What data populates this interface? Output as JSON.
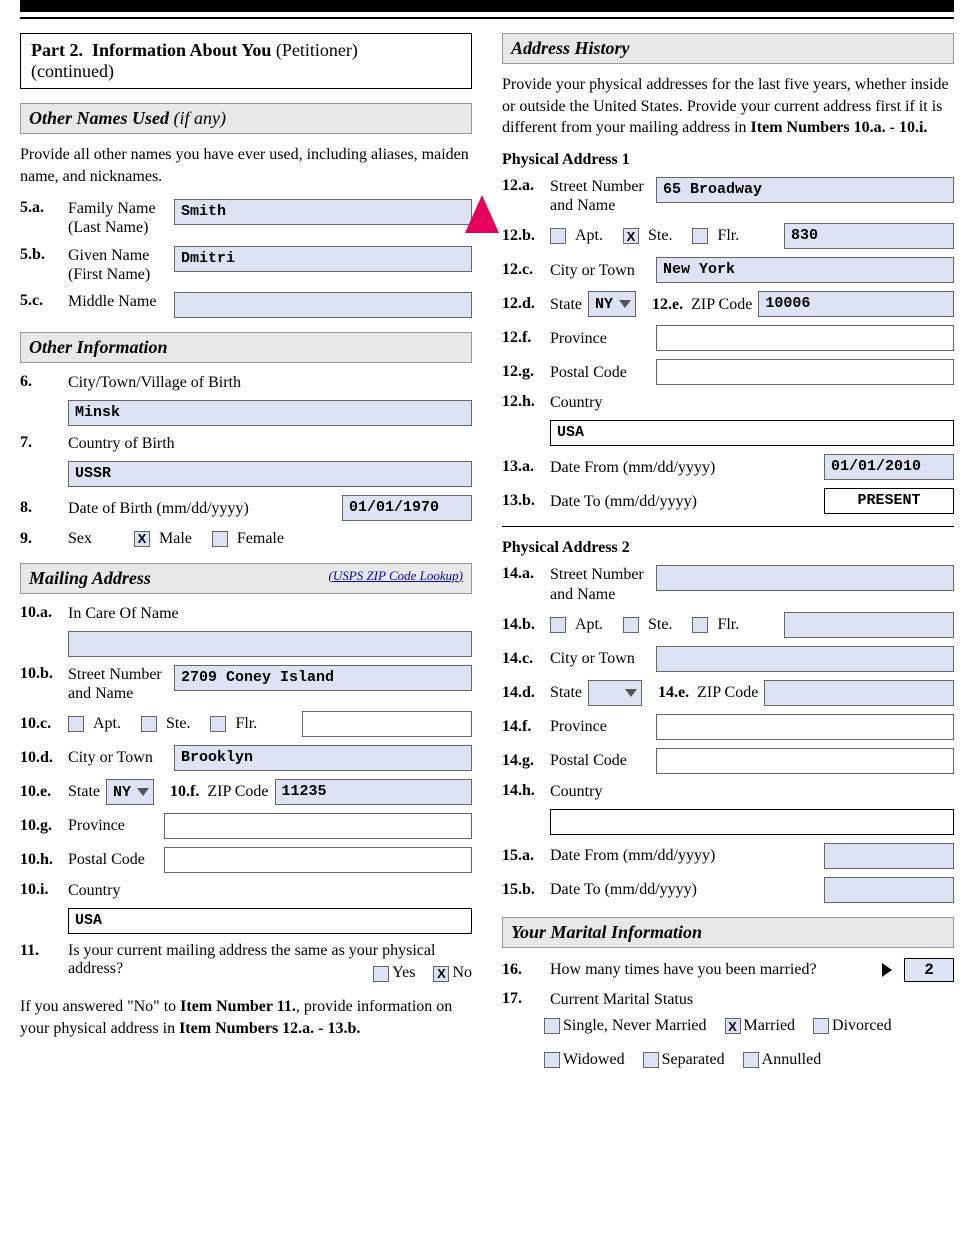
{
  "header": {
    "part": "Part 2.",
    "title": "Information About You",
    "paren": "(Petitioner)",
    "cont": "(continued)"
  },
  "s1": {
    "title": "Other Names Used",
    "paren": "(if any)",
    "instr": "Provide all other names you have ever used, including aliases, maiden name, and nicknames.",
    "a": {
      "n": "5.a.",
      "l1": "Family Name",
      "l2": "(Last Name)",
      "v": "Smith"
    },
    "b": {
      "n": "5.b.",
      "l1": "Given Name",
      "l2": "(First Name)",
      "v": "Dmitri"
    },
    "c": {
      "n": "5.c.",
      "l": "Middle Name",
      "v": ""
    }
  },
  "s2": {
    "title": "Other Information",
    "6": {
      "n": "6.",
      "l": "City/Town/Village of Birth",
      "v": "Minsk"
    },
    "7": {
      "n": "7.",
      "l": "Country of Birth",
      "v": "USSR"
    },
    "8": {
      "n": "8.",
      "l": "Date of Birth (mm/dd/yyyy)",
      "v": "01/01/1970"
    },
    "9": {
      "n": "9.",
      "l": "Sex",
      "male": "Male",
      "female": "Female",
      "maleChecked": "X",
      "femaleChecked": ""
    }
  },
  "s3": {
    "title": "Mailing Address",
    "link": "(USPS ZIP Code Lookup)",
    "10a": {
      "n": "10.a.",
      "l": "In Care Of Name",
      "v": ""
    },
    "10b": {
      "n": "10.b.",
      "l1": "Street Number",
      "l2": "and Name",
      "v": "2709 Coney Island"
    },
    "10c": {
      "n": "10.c.",
      "apt": "Apt.",
      "ste": "Ste.",
      "flr": "Flr.",
      "aptC": "",
      "steC": "",
      "flrC": "",
      "v": ""
    },
    "10d": {
      "n": "10.d.",
      "l": "City or Town",
      "v": "Brooklyn"
    },
    "10e": {
      "n": "10.e.",
      "l": "State",
      "v": "NY"
    },
    "10f": {
      "n": "10.f.",
      "l": "ZIP Code",
      "v": "11235"
    },
    "10g": {
      "n": "10.g.",
      "l": "Province",
      "v": ""
    },
    "10h": {
      "n": "10.h.",
      "l": "Postal Code",
      "v": ""
    },
    "10i": {
      "n": "10.i.",
      "l": "Country",
      "v": "USA"
    },
    "11": {
      "n": "11.",
      "q": "Is your current mailing address the same as your physical address?",
      "yes": "Yes",
      "no": "No",
      "yesC": "",
      "noC": "X"
    },
    "note1": "If you answered \"No\" to ",
    "note1b": "Item Number 11.",
    "note2": ", provide information on your physical address in ",
    "note2b": "Item Numbers 12.a. - 13.b."
  },
  "s4": {
    "title": "Address History",
    "instr1": "Provide your physical addresses for the last five years, whether inside or outside the United States.  Provide your current address first if it is different from your mailing address in ",
    "instr1b": "Item Numbers 10.a. - 10.i.",
    "p1": {
      "title": "Physical Address 1",
      "12a": {
        "n": "12.a.",
        "l1": "Street Number",
        "l2": "and Name",
        "v": "65 Broadway"
      },
      "12b": {
        "n": "12.b.",
        "apt": "Apt.",
        "ste": "Ste.",
        "flr": "Flr.",
        "aptC": "",
        "steC": "X",
        "flrC": "",
        "v": "830"
      },
      "12c": {
        "n": "12.c.",
        "l": "City or Town",
        "v": "New York"
      },
      "12d": {
        "n": "12.d.",
        "l": "State",
        "v": "NY"
      },
      "12e": {
        "n": "12.e.",
        "l": "ZIP Code",
        "v": "10006"
      },
      "12f": {
        "n": "12.f.",
        "l": "Province",
        "v": ""
      },
      "12g": {
        "n": "12.g.",
        "l": "Postal Code",
        "v": ""
      },
      "12h": {
        "n": "12.h.",
        "l": "Country",
        "v": "USA"
      },
      "13a": {
        "n": "13.a.",
        "l": "Date From (mm/dd/yyyy)",
        "v": "01/01/2010"
      },
      "13b": {
        "n": "13.b.",
        "l": "Date To (mm/dd/yyyy)",
        "v": "PRESENT"
      }
    },
    "p2": {
      "title": "Physical Address 2",
      "14a": {
        "n": "14.a.",
        "l1": "Street Number",
        "l2": "and Name",
        "v": ""
      },
      "14b": {
        "n": "14.b.",
        "apt": "Apt.",
        "ste": "Ste.",
        "flr": "Flr.",
        "aptC": "",
        "steC": "",
        "flrC": "",
        "v": ""
      },
      "14c": {
        "n": "14.c.",
        "l": "City or Town",
        "v": ""
      },
      "14d": {
        "n": "14.d.",
        "l": "State",
        "v": ""
      },
      "14e": {
        "n": "14.e.",
        "l": "ZIP Code",
        "v": ""
      },
      "14f": {
        "n": "14.f.",
        "l": "Province",
        "v": ""
      },
      "14g": {
        "n": "14.g.",
        "l": "Postal Code",
        "v": ""
      },
      "14h": {
        "n": "14.h.",
        "l": "Country",
        "v": ""
      },
      "15a": {
        "n": "15.a.",
        "l": "Date From (mm/dd/yyyy)",
        "v": ""
      },
      "15b": {
        "n": "15.b.",
        "l": "Date To (mm/dd/yyyy)",
        "v": ""
      }
    }
  },
  "s5": {
    "title": "Your Marital Information",
    "16": {
      "n": "16.",
      "q": "How many times have you been married?",
      "v": "2"
    },
    "17": {
      "n": "17.",
      "l": "Current Marital Status",
      "opts": [
        {
          "l": "Single, Never Married",
          "c": ""
        },
        {
          "l": "Married",
          "c": "X"
        },
        {
          "l": "Divorced",
          "c": ""
        },
        {
          "l": "Widowed",
          "c": ""
        },
        {
          "l": "Separated",
          "c": ""
        },
        {
          "l": "Annulled",
          "c": ""
        }
      ]
    }
  }
}
